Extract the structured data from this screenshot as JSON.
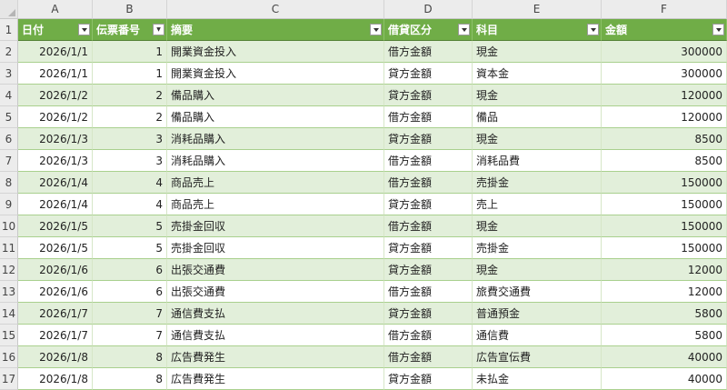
{
  "columns": [
    "A",
    "B",
    "C",
    "D",
    "E",
    "F"
  ],
  "headers": [
    {
      "label": "日付",
      "filter": "dropdown"
    },
    {
      "label": "伝票番号",
      "filter": "sorted-asc"
    },
    {
      "label": "摘要",
      "filter": "dropdown"
    },
    {
      "label": "借貸区分",
      "filter": "dropdown"
    },
    {
      "label": "科目",
      "filter": "dropdown"
    },
    {
      "label": "金額",
      "filter": "dropdown"
    }
  ],
  "header_row_number": "1",
  "rows": [
    {
      "n": "2",
      "date": "2026/1/1",
      "no": "1",
      "desc": "開業資金投入",
      "side": "借方金額",
      "account": "現金",
      "amount": "300000"
    },
    {
      "n": "3",
      "date": "2026/1/1",
      "no": "1",
      "desc": "開業資金投入",
      "side": "貸方金額",
      "account": "資本金",
      "amount": "300000"
    },
    {
      "n": "4",
      "date": "2026/1/2",
      "no": "2",
      "desc": "備品購入",
      "side": "貸方金額",
      "account": "現金",
      "amount": "120000"
    },
    {
      "n": "5",
      "date": "2026/1/2",
      "no": "2",
      "desc": "備品購入",
      "side": "借方金額",
      "account": "備品",
      "amount": "120000"
    },
    {
      "n": "6",
      "date": "2026/1/3",
      "no": "3",
      "desc": "消耗品購入",
      "side": "貸方金額",
      "account": "現金",
      "amount": "8500"
    },
    {
      "n": "7",
      "date": "2026/1/3",
      "no": "3",
      "desc": "消耗品購入",
      "side": "借方金額",
      "account": "消耗品費",
      "amount": "8500"
    },
    {
      "n": "8",
      "date": "2026/1/4",
      "no": "4",
      "desc": "商品売上",
      "side": "借方金額",
      "account": "売掛金",
      "amount": "150000"
    },
    {
      "n": "9",
      "date": "2026/1/4",
      "no": "4",
      "desc": "商品売上",
      "side": "貸方金額",
      "account": "売上",
      "amount": "150000"
    },
    {
      "n": "10",
      "date": "2026/1/5",
      "no": "5",
      "desc": "売掛金回収",
      "side": "借方金額",
      "account": "現金",
      "amount": "150000"
    },
    {
      "n": "11",
      "date": "2026/1/5",
      "no": "5",
      "desc": "売掛金回収",
      "side": "貸方金額",
      "account": "売掛金",
      "amount": "150000"
    },
    {
      "n": "12",
      "date": "2026/1/6",
      "no": "6",
      "desc": "出張交通費",
      "side": "貸方金額",
      "account": "現金",
      "amount": "12000"
    },
    {
      "n": "13",
      "date": "2026/1/6",
      "no": "6",
      "desc": "出張交通費",
      "side": "借方金額",
      "account": "旅費交通費",
      "amount": "12000"
    },
    {
      "n": "14",
      "date": "2026/1/7",
      "no": "7",
      "desc": "通信費支払",
      "side": "貸方金額",
      "account": "普通預金",
      "amount": "5800"
    },
    {
      "n": "15",
      "date": "2026/1/7",
      "no": "7",
      "desc": "通信費支払",
      "side": "借方金額",
      "account": "通信費",
      "amount": "5800"
    },
    {
      "n": "16",
      "date": "2026/1/8",
      "no": "8",
      "desc": "広告費発生",
      "side": "借方金額",
      "account": "広告宣伝費",
      "amount": "40000"
    },
    {
      "n": "17",
      "date": "2026/1/8",
      "no": "8",
      "desc": "広告費発生",
      "side": "貸方金額",
      "account": "未払金",
      "amount": "40000"
    }
  ],
  "colors": {
    "header_green": "#70ad47",
    "band_green": "#e2efda",
    "grid_gray": "#ececec"
  }
}
